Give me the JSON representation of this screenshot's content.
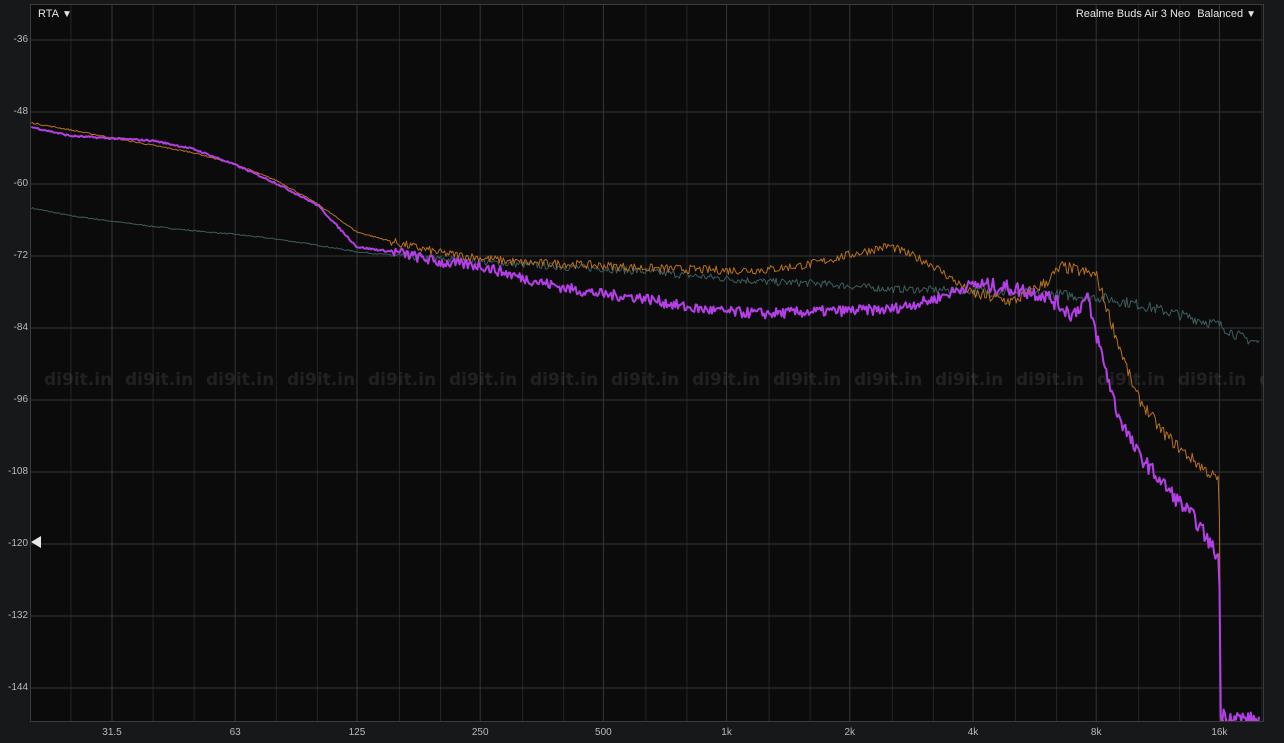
{
  "toolbar": {
    "mode_label": "RTA",
    "device_label": "Realme Buds Air 3 Neo",
    "preset_label": "Balanced",
    "dropdown_glyph": "▼"
  },
  "watermark": {
    "text": "di9it.in"
  },
  "colors": {
    "background": "#0b0b0c",
    "grid": "#34373a",
    "tick_text": "#b7b9bb",
    "series_orange": "#b8711c",
    "series_purple": "#b43fe6",
    "series_teal": "#3d5c5c"
  },
  "chart_data": {
    "type": "line",
    "x_scale": "log",
    "y_ticks": [
      -36,
      -48,
      -60,
      -72,
      -84,
      -96,
      -108,
      -120,
      -132,
      -144
    ],
    "x_ticks": [
      {
        "label": "31.5",
        "value": 31.5
      },
      {
        "label": "63",
        "value": 63
      },
      {
        "label": "125",
        "value": 125
      },
      {
        "label": "250",
        "value": 250
      },
      {
        "label": "500",
        "value": 500
      },
      {
        "label": "1k",
        "value": 1000
      },
      {
        "label": "2k",
        "value": 2000
      },
      {
        "label": "4k",
        "value": 4000
      },
      {
        "label": "8k",
        "value": 8000
      },
      {
        "label": "16k",
        "value": 16000
      }
    ],
    "xlim": [
      20,
      20000
    ],
    "ylim": [
      -150,
      -32
    ],
    "grid": true,
    "series": [
      {
        "color": "#3d5c5c",
        "width": 1,
        "noise": 0.7,
        "points": [
          [
            20,
            -64
          ],
          [
            25,
            -65.3
          ],
          [
            31.5,
            -66.2
          ],
          [
            40,
            -67.1
          ],
          [
            50,
            -67.8
          ],
          [
            63,
            -68.4
          ],
          [
            80,
            -69.2
          ],
          [
            100,
            -70.2
          ],
          [
            125,
            -71.3
          ],
          [
            160,
            -72
          ],
          [
            200,
            -72.5
          ],
          [
            250,
            -73
          ],
          [
            315,
            -73.4
          ],
          [
            400,
            -73.8
          ],
          [
            500,
            -74.1
          ],
          [
            630,
            -74.6
          ],
          [
            800,
            -75.2
          ],
          [
            1000,
            -75.8
          ],
          [
            1250,
            -76.3
          ],
          [
            1600,
            -76.5
          ],
          [
            2000,
            -77
          ],
          [
            2500,
            -77.5
          ],
          [
            3150,
            -77.6
          ],
          [
            4000,
            -77.8
          ],
          [
            5000,
            -78.1
          ],
          [
            6300,
            -78.4
          ],
          [
            8000,
            -78.8
          ],
          [
            10000,
            -80
          ],
          [
            12500,
            -81.6
          ],
          [
            16000,
            -83.5
          ],
          [
            18000,
            -85.5
          ],
          [
            20000,
            -86.5
          ]
        ]
      },
      {
        "color": "#b8711c",
        "width": 1,
        "noise": 0.8,
        "points": [
          [
            20,
            -49.8
          ],
          [
            25,
            -51
          ],
          [
            31.5,
            -52.3
          ],
          [
            40,
            -53.6
          ],
          [
            50,
            -54.8
          ],
          [
            63,
            -56.7
          ],
          [
            80,
            -59.5
          ],
          [
            100,
            -63.3
          ],
          [
            125,
            -68
          ],
          [
            160,
            -70
          ],
          [
            200,
            -71.5
          ],
          [
            250,
            -72.3
          ],
          [
            315,
            -73.1
          ],
          [
            400,
            -73.3
          ],
          [
            500,
            -73.6
          ],
          [
            630,
            -74
          ],
          [
            800,
            -74.2
          ],
          [
            1000,
            -74.4
          ],
          [
            1250,
            -74.3
          ],
          [
            1600,
            -73.4
          ],
          [
            2000,
            -71.8
          ],
          [
            2500,
            -70.3
          ],
          [
            3150,
            -73.3
          ],
          [
            4000,
            -78.3
          ],
          [
            5000,
            -79.6
          ],
          [
            6000,
            -76.5
          ],
          [
            6600,
            -73.8
          ],
          [
            8000,
            -75.2
          ],
          [
            9000,
            -86
          ],
          [
            10000,
            -95
          ],
          [
            11500,
            -101
          ],
          [
            13000,
            -104.5
          ],
          [
            15000,
            -108
          ],
          [
            16000,
            -109.5
          ],
          [
            16050,
            -150
          ],
          [
            20000,
            -150
          ]
        ]
      },
      {
        "color": "#b43fe6",
        "width": 2,
        "noise": 1.0,
        "points": [
          [
            20,
            -50.5
          ],
          [
            25,
            -52
          ],
          [
            31.5,
            -52.4
          ],
          [
            40,
            -52.8
          ],
          [
            50,
            -54.2
          ],
          [
            63,
            -56.8
          ],
          [
            80,
            -60
          ],
          [
            100,
            -63.5
          ],
          [
            125,
            -70.5
          ],
          [
            160,
            -71.5
          ],
          [
            200,
            -73.1
          ],
          [
            250,
            -73.6
          ],
          [
            315,
            -75.6
          ],
          [
            400,
            -77.3
          ],
          [
            500,
            -78.4
          ],
          [
            630,
            -79
          ],
          [
            800,
            -80.6
          ],
          [
            1000,
            -81.3
          ],
          [
            1250,
            -81.6
          ],
          [
            1600,
            -81.3
          ],
          [
            2000,
            -81.1
          ],
          [
            2500,
            -80.9
          ],
          [
            3150,
            -79.4
          ],
          [
            4000,
            -76.7
          ],
          [
            5000,
            -77.4
          ],
          [
            6000,
            -78.5
          ],
          [
            7000,
            -81.8
          ],
          [
            7600,
            -79
          ],
          [
            8000,
            -85
          ],
          [
            9000,
            -98
          ],
          [
            10000,
            -104.5
          ],
          [
            12000,
            -111
          ],
          [
            14000,
            -116
          ],
          [
            16000,
            -122.5
          ],
          [
            16050,
            -148.5
          ],
          [
            20000,
            -149.5
          ]
        ]
      }
    ]
  }
}
